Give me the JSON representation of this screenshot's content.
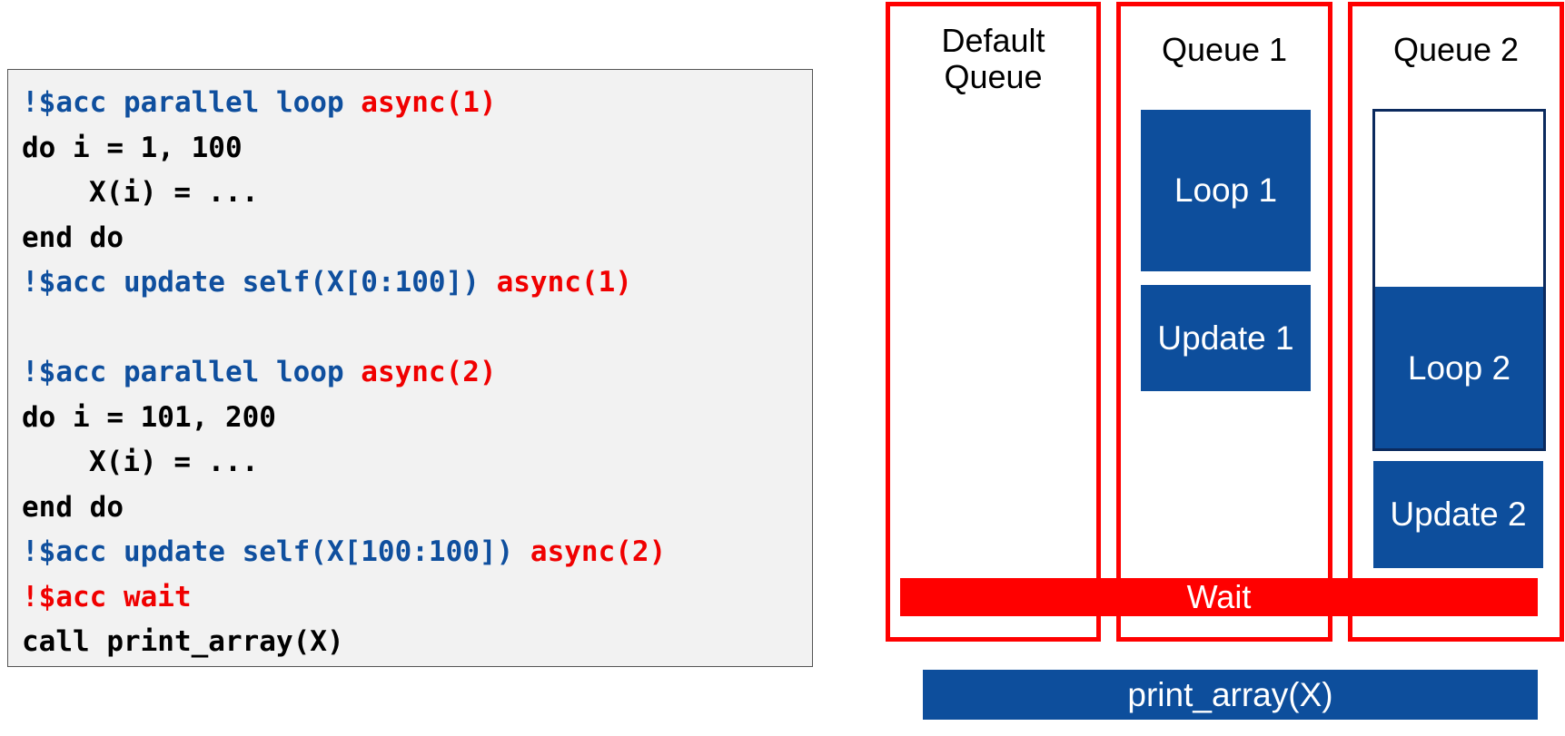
{
  "code": {
    "lines": [
      {
        "indent": false,
        "tokens": [
          {
            "t": "!$acc parallel loop ",
            "k": "dir"
          },
          {
            "t": "async(1)",
            "k": "async"
          }
        ]
      },
      {
        "indent": false,
        "tokens": [
          {
            "t": "do i = 1, 100",
            "k": "plain"
          }
        ]
      },
      {
        "indent": true,
        "tokens": [
          {
            "t": "X(i) = ...",
            "k": "plain"
          }
        ]
      },
      {
        "indent": false,
        "tokens": [
          {
            "t": "end do",
            "k": "plain"
          }
        ]
      },
      {
        "indent": false,
        "tokens": [
          {
            "t": "!$acc update self(X[0:100]) ",
            "k": "dir"
          },
          {
            "t": "async(1)",
            "k": "async"
          }
        ]
      },
      {
        "indent": false,
        "tokens": []
      },
      {
        "indent": false,
        "tokens": [
          {
            "t": "!$acc parallel loop ",
            "k": "dir"
          },
          {
            "t": "async(2)",
            "k": "async"
          }
        ]
      },
      {
        "indent": false,
        "tokens": [
          {
            "t": "do i = 101, 200",
            "k": "plain"
          }
        ]
      },
      {
        "indent": true,
        "tokens": [
          {
            "t": "X(i) = ...",
            "k": "plain"
          }
        ]
      },
      {
        "indent": false,
        "tokens": [
          {
            "t": "end do",
            "k": "plain"
          }
        ]
      },
      {
        "indent": false,
        "tokens": [
          {
            "t": "!$acc update self(X[100:100]) ",
            "k": "dir"
          },
          {
            "t": "async(2)",
            "k": "async"
          }
        ]
      },
      {
        "indent": false,
        "tokens": [
          {
            "t": "!$acc wait",
            "k": "async"
          }
        ]
      },
      {
        "indent": false,
        "tokens": [
          {
            "t": "call print_array(X)",
            "k": "plain"
          }
        ]
      }
    ]
  },
  "queues": {
    "default": {
      "title_line1": "Default",
      "title_line2": "Queue"
    },
    "q1": {
      "title": "Queue 1",
      "loop_label": "Loop 1",
      "update_label": "Update 1"
    },
    "q2": {
      "title": "Queue 2",
      "loop_label": "Loop 2",
      "loop_progress": 0.48,
      "update_label": "Update 2"
    }
  },
  "wait_label": "Wait",
  "print_label": "print_array(X)",
  "colors": {
    "directive": "#0f4f9e",
    "async": "#f00000",
    "queue_border": "#ff0000",
    "task_fill": "#0d4e9c",
    "code_bg": "#f2f2f2"
  }
}
